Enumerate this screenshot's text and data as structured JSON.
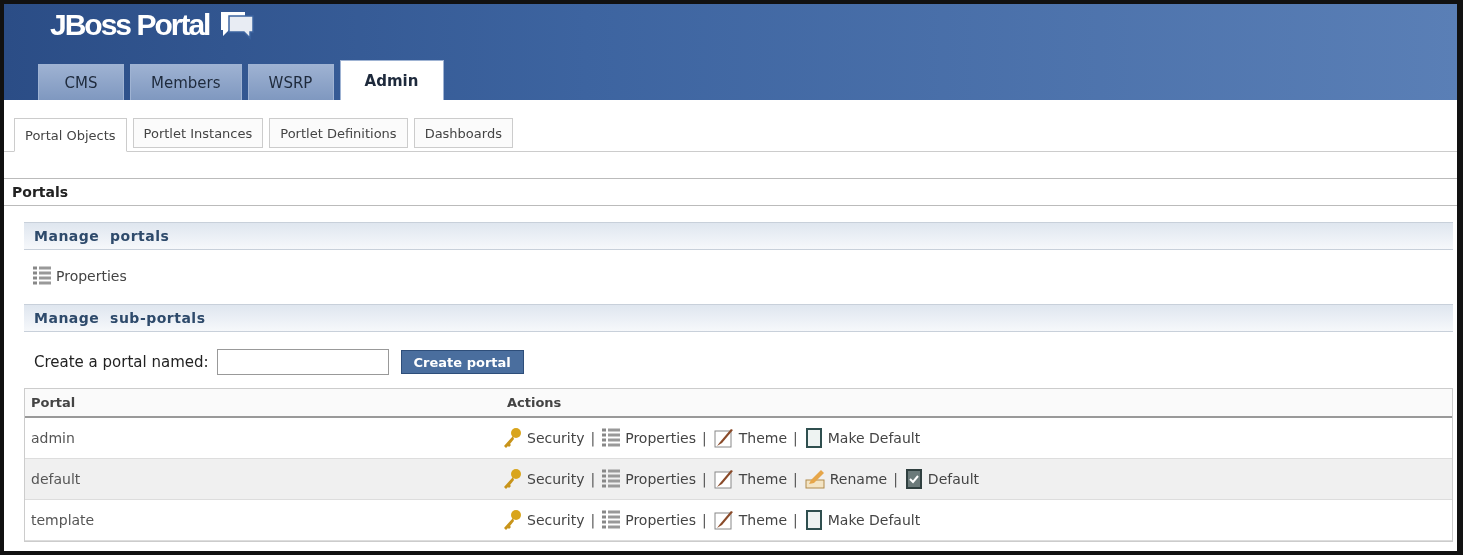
{
  "header": {
    "logo": "JBoss Portal"
  },
  "main_tabs": [
    {
      "label": "CMS",
      "selected": false
    },
    {
      "label": "Members",
      "selected": false
    },
    {
      "label": "WSRP",
      "selected": false
    },
    {
      "label": "Admin",
      "selected": true
    }
  ],
  "sub_tabs": [
    {
      "label": "Portal Objects",
      "selected": true
    },
    {
      "label": "Portlet Instances",
      "selected": false
    },
    {
      "label": "Portlet Definitions",
      "selected": false
    },
    {
      "label": "Dashboards",
      "selected": false
    }
  ],
  "section_title": "Portals",
  "manage_portals": {
    "title": "Manage  portals",
    "link": "Properties"
  },
  "manage_sub_portals": {
    "title": "Manage  sub-portals",
    "create_label": "Create a portal named:",
    "create_button": "Create portal"
  },
  "table": {
    "columns": [
      "Portal",
      "Actions"
    ],
    "separator": "|",
    "rows": [
      {
        "portal": "admin",
        "actions": [
          {
            "kind": "security",
            "label": "Security"
          },
          {
            "kind": "properties",
            "label": "Properties"
          },
          {
            "kind": "theme",
            "label": "Theme"
          },
          {
            "kind": "make_default",
            "label": "Make Default"
          }
        ]
      },
      {
        "portal": "default",
        "actions": [
          {
            "kind": "security",
            "label": "Security"
          },
          {
            "kind": "properties",
            "label": "Properties"
          },
          {
            "kind": "theme",
            "label": "Theme"
          },
          {
            "kind": "rename",
            "label": "Rename"
          },
          {
            "kind": "default",
            "label": "Default"
          }
        ]
      },
      {
        "portal": "template",
        "actions": [
          {
            "kind": "security",
            "label": "Security"
          },
          {
            "kind": "properties",
            "label": "Properties"
          },
          {
            "kind": "theme",
            "label": "Theme"
          },
          {
            "kind": "make_default",
            "label": "Make Default"
          }
        ]
      }
    ]
  }
}
